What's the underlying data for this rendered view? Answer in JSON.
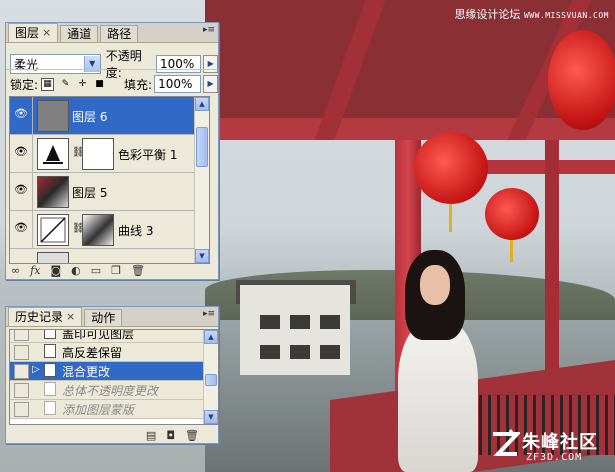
{
  "watermark": {
    "top_cn": "思缘设计论坛",
    "top_site": "WWW.MISSVUAN.COM",
    "logo_cn": "朱峰社区",
    "logo_site": "ZF3D.COM"
  },
  "layers_panel": {
    "tabs": [
      {
        "label": "图层",
        "close": "×",
        "active": true
      },
      {
        "label": "通道",
        "active": false
      },
      {
        "label": "路径",
        "active": false
      }
    ],
    "menu_icon": "panel-menu-icon",
    "blend_mode": "柔光",
    "opacity_label": "不透明度:",
    "opacity_value": "100%",
    "lock_label": "锁定:",
    "fill_label": "填充:",
    "fill_value": "100%",
    "layers": [
      {
        "name": "图层 6",
        "selected": true,
        "visible": true,
        "has_mask": false
      },
      {
        "name": "色彩平衡 1",
        "selected": false,
        "visible": true,
        "has_mask": true
      },
      {
        "name": "图层 5",
        "selected": false,
        "visible": true,
        "has_mask": false
      },
      {
        "name": "曲线 3",
        "selected": false,
        "visible": true,
        "has_mask": true
      }
    ],
    "footer_icons": [
      "link-layers-icon",
      "fx-icon",
      "add-mask-icon",
      "adjustment-layer-icon",
      "new-group-icon",
      "new-layer-icon",
      "trash-icon"
    ],
    "fx_label": "fx"
  },
  "history_panel": {
    "tabs": [
      {
        "label": "历史记录",
        "close": "×",
        "active": true
      },
      {
        "label": "动作",
        "active": false
      }
    ],
    "items": [
      {
        "label": "盖印可见图层",
        "state": "past"
      },
      {
        "label": "高反差保留",
        "state": "past"
      },
      {
        "label": "混合更改",
        "state": "current"
      },
      {
        "label": "总体不透明度更改",
        "state": "future"
      },
      {
        "label": "添加图层蒙版",
        "state": "future"
      }
    ],
    "footer_icons": [
      "new-document-from-state-icon",
      "snapshot-icon",
      "trash-icon"
    ]
  },
  "colors": {
    "selection": "#3169c6",
    "panel_bg": "#ece9d8",
    "lantern_red": "#c41414"
  }
}
